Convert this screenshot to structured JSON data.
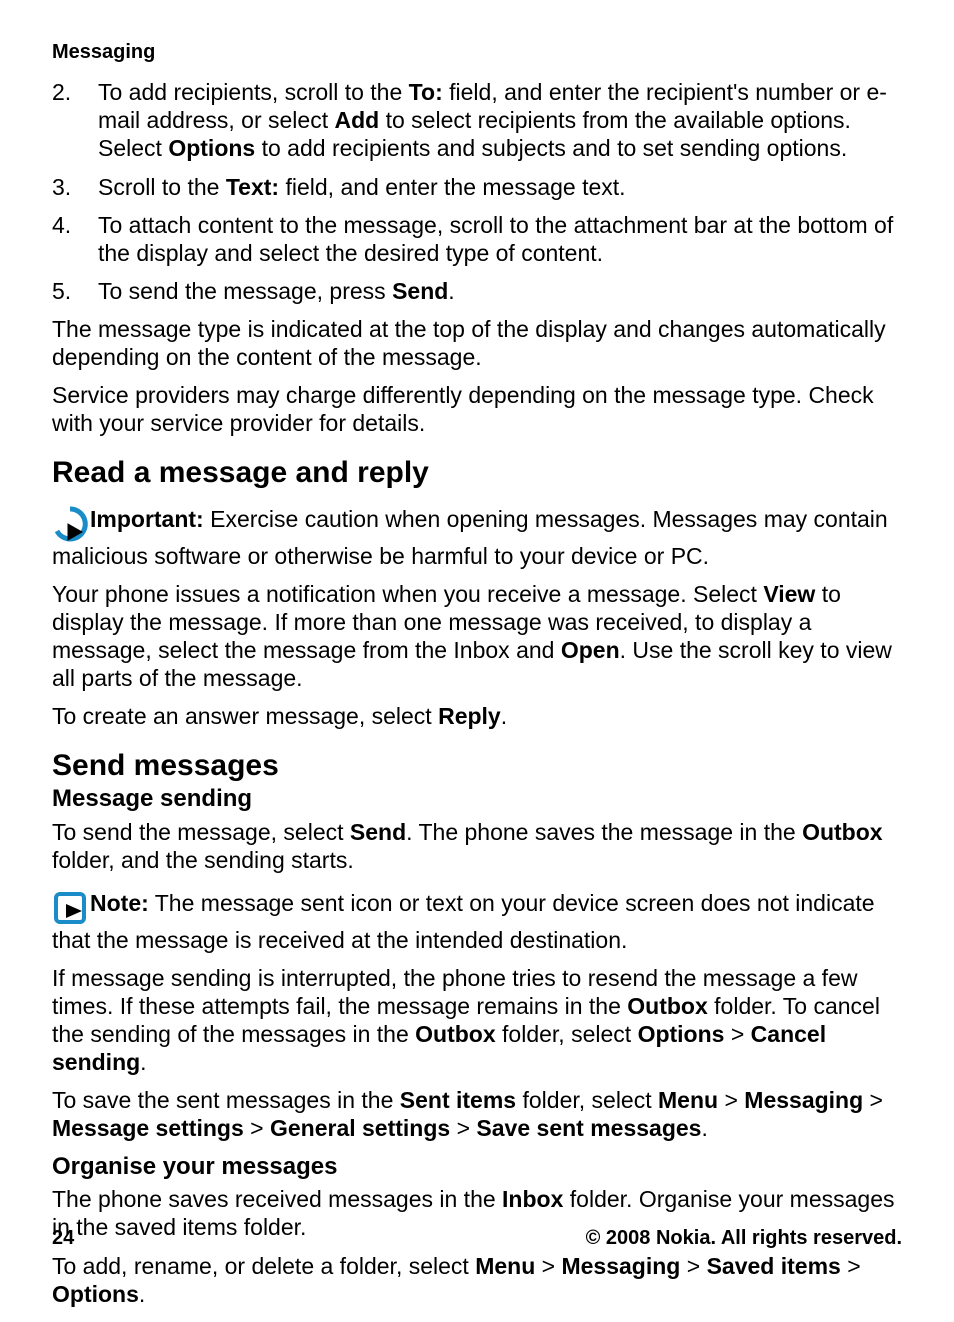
{
  "header": "Messaging",
  "steps": [
    {
      "num": "2.",
      "parts": [
        {
          "t": "To add recipients, scroll to the "
        },
        {
          "t": "To:",
          "b": true
        },
        {
          "t": " field, and enter the recipient's number or e-mail address, or select "
        },
        {
          "t": "Add",
          "b": true
        },
        {
          "t": " to select recipients from the available options. Select "
        },
        {
          "t": "Options",
          "b": true
        },
        {
          "t": " to add recipients and subjects and to set sending options."
        }
      ]
    },
    {
      "num": "3.",
      "parts": [
        {
          "t": "Scroll to the "
        },
        {
          "t": "Text:",
          "b": true
        },
        {
          "t": " field, and enter the message text."
        }
      ]
    },
    {
      "num": "4.",
      "parts": [
        {
          "t": "To attach content to the message, scroll to the attachment bar at the bottom of the display and select the desired type of content."
        }
      ]
    },
    {
      "num": "5.",
      "parts": [
        {
          "t": "To send the message, press "
        },
        {
          "t": "Send",
          "b": true
        },
        {
          "t": "."
        }
      ]
    }
  ],
  "para_after_steps_1": "The message type is indicated at the top of the display and changes automatically depending on the content of the message.",
  "para_after_steps_2": "Service providers may charge differently depending on the message type. Check with your service provider for details.",
  "section_read": "Read a message and reply",
  "important_label": "Important:",
  "important_text": " Exercise caution when opening messages. Messages may contain malicious software or otherwise be harmful to your device or PC.",
  "read_para_parts": [
    {
      "t": "Your phone issues a notification when you receive a message. Select "
    },
    {
      "t": "View",
      "b": true
    },
    {
      "t": " to display the message. If more than one message was received, to display a message, select the message from the Inbox and "
    },
    {
      "t": "Open",
      "b": true
    },
    {
      "t": ". Use the scroll key to view all parts of the message."
    }
  ],
  "reply_para_parts": [
    {
      "t": "To create an answer message, select "
    },
    {
      "t": "Reply",
      "b": true
    },
    {
      "t": "."
    }
  ],
  "section_send": "Send messages",
  "sub_msg_sending": "Message sending",
  "send_para_parts": [
    {
      "t": "To send the message, select "
    },
    {
      "t": "Send",
      "b": true
    },
    {
      "t": ". The phone saves the message in the "
    },
    {
      "t": "Outbox",
      "b": true
    },
    {
      "t": " folder, and the sending starts."
    }
  ],
  "note_label": "Note:",
  "note_text": " The message sent icon or text on your device screen does not indicate that the message is received at the intended destination.",
  "interrupt_para_parts": [
    {
      "t": "If message sending is interrupted, the phone tries to resend the message a few times. If these attempts fail, the message remains in the "
    },
    {
      "t": "Outbox",
      "b": true
    },
    {
      "t": " folder. To cancel the sending of the messages in the "
    },
    {
      "t": "Outbox",
      "b": true
    },
    {
      "t": " folder, select "
    },
    {
      "t": "Options",
      "b": true
    },
    {
      "t": " > "
    },
    {
      "t": "Cancel sending",
      "b": true
    },
    {
      "t": "."
    }
  ],
  "save_sent_para_parts": [
    {
      "t": "To save the sent messages in the "
    },
    {
      "t": "Sent items",
      "b": true
    },
    {
      "t": " folder, select "
    },
    {
      "t": "Menu",
      "b": true
    },
    {
      "t": " > "
    },
    {
      "t": "Messaging",
      "b": true
    },
    {
      "t": " > "
    },
    {
      "t": "Message settings",
      "b": true
    },
    {
      "t": " > "
    },
    {
      "t": "General settings",
      "b": true
    },
    {
      "t": " > "
    },
    {
      "t": "Save sent messages",
      "b": true
    },
    {
      "t": "."
    }
  ],
  "sub_organise": "Organise your messages",
  "organise_para_parts": [
    {
      "t": "The phone saves received messages in the "
    },
    {
      "t": "Inbox",
      "b": true
    },
    {
      "t": " folder. Organise your messages in the saved items folder."
    }
  ],
  "folder_para_parts": [
    {
      "t": "To add, rename, or delete a folder, select "
    },
    {
      "t": "Menu",
      "b": true
    },
    {
      "t": " > "
    },
    {
      "t": "Messaging",
      "b": true
    },
    {
      "t": " > "
    },
    {
      "t": "Saved items",
      "b": true
    },
    {
      "t": " > "
    },
    {
      "t": "Options",
      "b": true
    },
    {
      "t": "."
    }
  ],
  "footer": {
    "page": "24",
    "copyright": "© 2008 Nokia. All rights reserved."
  }
}
